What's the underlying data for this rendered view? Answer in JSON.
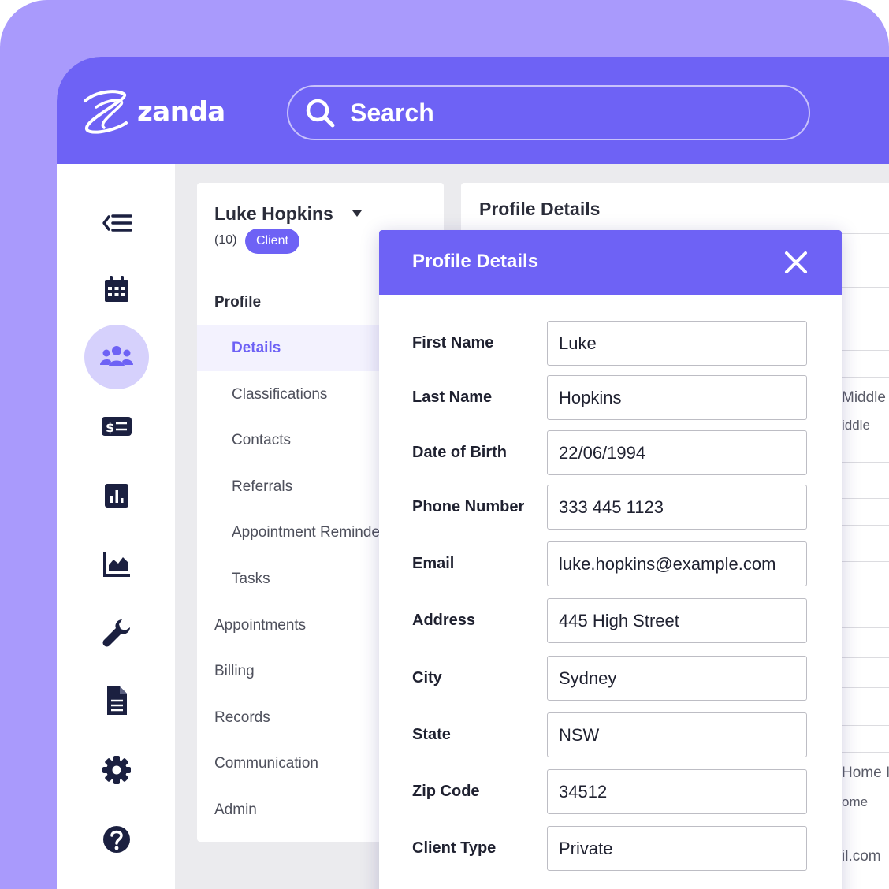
{
  "brand": {
    "name": "zanda"
  },
  "search": {
    "placeholder": "Search"
  },
  "rail": {
    "items": [
      {
        "icon": "collapse-menu-icon"
      },
      {
        "icon": "calendar-icon"
      },
      {
        "icon": "clients-icon",
        "active": true
      },
      {
        "icon": "billing-icon"
      },
      {
        "icon": "reports-icon"
      },
      {
        "icon": "analytics-icon"
      },
      {
        "icon": "tools-icon"
      },
      {
        "icon": "document-icon"
      },
      {
        "icon": "settings-icon"
      },
      {
        "icon": "help-icon"
      }
    ]
  },
  "client": {
    "name": "Luke Hopkins",
    "count": "(10)",
    "badge": "Client"
  },
  "nav": {
    "items": [
      {
        "label": "Profile",
        "level": 1,
        "header": true
      },
      {
        "label": "Details",
        "level": 2,
        "selected": true
      },
      {
        "label": "Classifications",
        "level": 2
      },
      {
        "label": "Contacts",
        "level": 2
      },
      {
        "label": "Referrals",
        "level": 2
      },
      {
        "label": "Appointment Reminders",
        "level": 2
      },
      {
        "label": "Tasks",
        "level": 2
      },
      {
        "label": "Appointments",
        "level": 1
      },
      {
        "label": "Billing",
        "level": 1
      },
      {
        "label": "Records",
        "level": 1
      },
      {
        "label": "Communication",
        "level": 1
      },
      {
        "label": "Admin",
        "level": 1
      }
    ]
  },
  "background_panel": {
    "title": "Profile Details",
    "peek": [
      "Middle",
      "iddle",
      "Home I",
      "ome",
      "il.com"
    ]
  },
  "modal": {
    "title": "Profile Details",
    "fields": [
      {
        "label": "First Name",
        "value": "Luke"
      },
      {
        "label": "Last Name",
        "value": "Hopkins"
      },
      {
        "label": "Date of Birth",
        "value": "22/06/1994"
      },
      {
        "label": "Phone Number",
        "value": "333 445 1123"
      },
      {
        "label": "Email",
        "value": "luke.hopkins@example.com"
      },
      {
        "label": "Address",
        "value": "445 High Street"
      },
      {
        "label": "City",
        "value": "Sydney"
      },
      {
        "label": "State",
        "value": "NSW"
      },
      {
        "label": "Zip Code",
        "value": "34512"
      },
      {
        "label": "Client Type",
        "value": "Private"
      }
    ]
  },
  "colors": {
    "brand": "#6e62f5",
    "frame": "#a99afc",
    "icon": "#1b2040",
    "active_bg": "#d6d1fc"
  }
}
